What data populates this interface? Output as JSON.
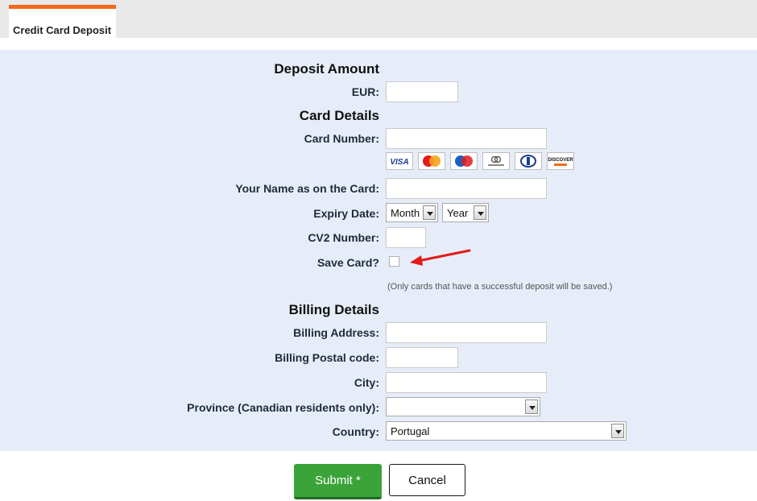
{
  "tab": {
    "label": "Credit Card Deposit"
  },
  "deposit": {
    "title": "Deposit Amount",
    "currency_label": "EUR:",
    "amount_value": ""
  },
  "card": {
    "title": "Card Details",
    "number_label": "Card Number:",
    "number_value": "",
    "logos": [
      "VISA",
      "MasterCard",
      "Maestro",
      "entropay",
      "Diners Club",
      "DISCOVER"
    ],
    "name_label": "Your Name as on the Card:",
    "name_value": "",
    "expiry_label": "Expiry Date:",
    "month_value": "Month",
    "year_value": "Year",
    "cv2_label": "CV2 Number:",
    "cv2_value": "",
    "save_label": "Save Card?",
    "save_note": "(Only cards that have a successful deposit will be saved.)"
  },
  "billing": {
    "title": "Billing Details",
    "address_label": "Billing Address:",
    "address_value": "",
    "postal_label": "Billing Postal code:",
    "postal_value": "",
    "city_label": "City:",
    "city_value": "",
    "province_label": "Province (Canadian residents only):",
    "province_value": "",
    "country_label": "Country:",
    "country_value": "Portugal"
  },
  "buttons": {
    "submit": "Submit *",
    "cancel": "Cancel"
  },
  "colors": {
    "tab_accent": "#f26b1d",
    "panel_bg": "#e6edf9",
    "submit_bg": "#3aa33a",
    "arrow": "#e21b1b"
  }
}
